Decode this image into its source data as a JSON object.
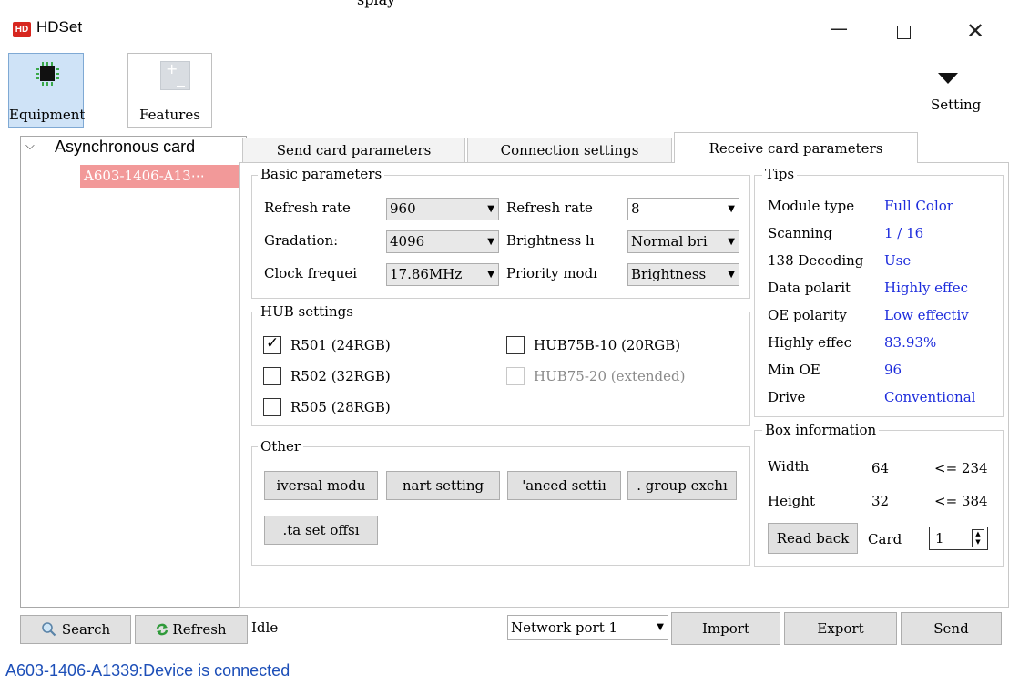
{
  "top_caption": "splay",
  "window": {
    "logo_text": "HD",
    "title": "HDSet",
    "minimize_glyph": "—",
    "close_glyph": "✕"
  },
  "toolbar": {
    "equipment_label": "Equipment",
    "features_label": "Features",
    "setting_label": "Setting"
  },
  "tree": {
    "root_label": "Asynchronous card",
    "device_label": "A603-1406-A13⋯"
  },
  "left_buttons": {
    "search_label": "Search",
    "refresh_label": "Refresh"
  },
  "status": {
    "idle": "Idle",
    "message": "A603-1406-A1339:Device is connected"
  },
  "tabs": {
    "send_card": "Send card parameters",
    "connection": "Connection settings",
    "receive_card": "Receive card parameters"
  },
  "basic": {
    "title": "Basic parameters",
    "refresh_rate_label": "Refresh rate",
    "refresh_rate_value": "960",
    "refresh_rate2_label": "Refresh rate",
    "refresh_rate2_value": "8",
    "gradation_label": "Gradation:",
    "gradation_value": "4096",
    "brightness_label": "Brightness lı",
    "brightness_value": "Normal bri",
    "clock_label": "Clock frequei",
    "clock_value": "17.86MHz",
    "priority_label": "Priority modı",
    "priority_value": "Brightness"
  },
  "hub": {
    "title": "HUB settings",
    "r501": "R501 (24RGB)",
    "r502": "R502 (32RGB)",
    "r505": "R505 (28RGB)",
    "hub75b": "HUB75B-10 (20RGB)",
    "hub75": "HUB75-20 (extended)",
    "r501_checked": true
  },
  "other": {
    "title": "Other",
    "btn1": "iversal modu",
    "btn2": "nart setting",
    "btn3": "'anced settiı",
    "btn4": ". group exchı",
    "btn5": ".ta set offsı"
  },
  "tips": {
    "title": "Tips",
    "rows": [
      {
        "label": "Module type",
        "value": "Full Color"
      },
      {
        "label": "Scanning",
        "value": "1 / 16"
      },
      {
        "label": "138 Decoding",
        "value": "Use"
      },
      {
        "label": "Data polarit",
        "value": "Highly effec"
      },
      {
        "label": "OE polarity",
        "value": "Low effectiv"
      },
      {
        "label": "Highly effec",
        "value": "83.93%"
      },
      {
        "label": "Min OE",
        "value": "96"
      },
      {
        "label": "Drive",
        "value": "Conventional"
      }
    ]
  },
  "box_info": {
    "title": "Box information",
    "width_label": "Width",
    "width_value": "64",
    "width_limit": "<= 234",
    "height_label": "Height",
    "height_value": "32",
    "height_limit": "<= 384",
    "read_back_label": "Read back",
    "card_label": "Card",
    "card_value": "1"
  },
  "actions": {
    "network_port": "Network port 1",
    "import_label": "Import",
    "export_label": "Export",
    "send_label": "Send"
  },
  "colors": {
    "selected_tool_bg": "#cfe3f7",
    "device_item_bg": "#f29999",
    "tip_value": "#1d2cdc",
    "status_message": "#1d4fb8",
    "logo_red": "#d7261f"
  }
}
